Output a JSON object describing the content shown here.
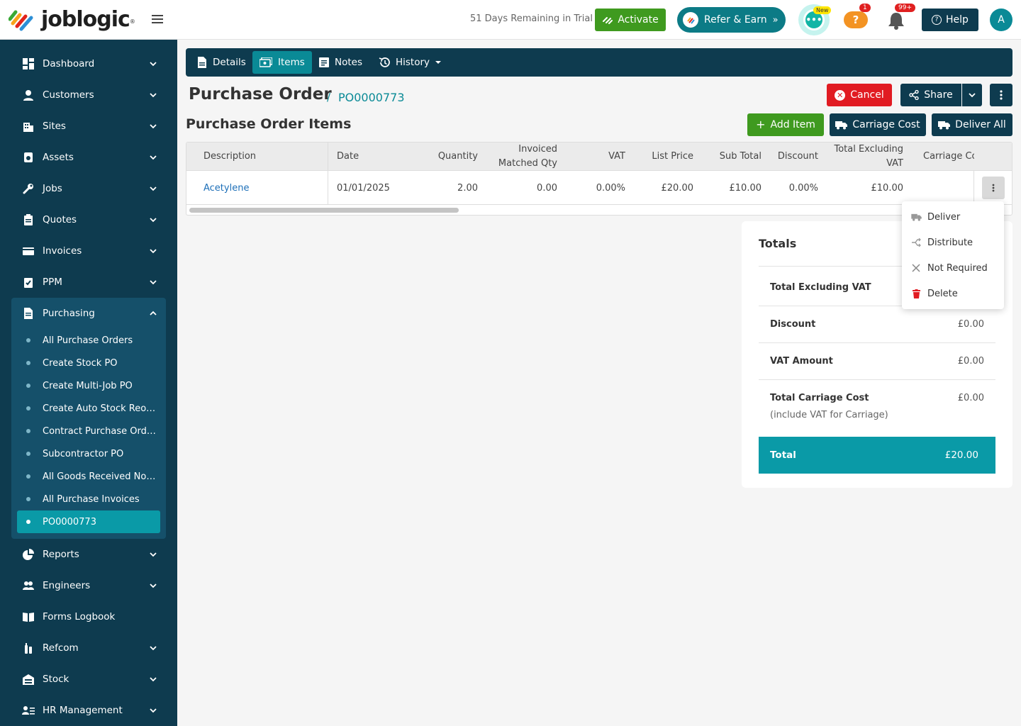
{
  "brand": {
    "logo_text": "joblogic"
  },
  "topbar": {
    "trial_text": "51 Days Remaining in Trial",
    "activate_label": "Activate",
    "refer_label": "Refer & Earn",
    "chat_badge": "New",
    "help_badge": "1",
    "notifications_badge": "99+",
    "help_label": "Help",
    "avatar_initial": "A"
  },
  "sidebar": {
    "items": [
      {
        "label": "Dashboard"
      },
      {
        "label": "Customers"
      },
      {
        "label": "Sites"
      },
      {
        "label": "Assets"
      },
      {
        "label": "Jobs"
      },
      {
        "label": "Quotes"
      },
      {
        "label": "Invoices"
      },
      {
        "label": "PPM"
      },
      {
        "label": "Purchasing"
      },
      {
        "label": "Reports"
      },
      {
        "label": "Engineers"
      },
      {
        "label": "Forms Logbook"
      },
      {
        "label": "Refcom"
      },
      {
        "label": "Stock"
      },
      {
        "label": "HR Management"
      }
    ],
    "purchasing_sub": [
      {
        "label": "All Purchase Orders"
      },
      {
        "label": "Create Stock PO"
      },
      {
        "label": "Create Multi-Job PO"
      },
      {
        "label": "Create Auto Stock Reord..."
      },
      {
        "label": "Contract Purchase Orders"
      },
      {
        "label": "Subcontractor PO"
      },
      {
        "label": "All Goods Received Notes"
      },
      {
        "label": "All Purchase Invoices"
      },
      {
        "label": "PO0000773"
      }
    ]
  },
  "tabs": [
    {
      "label": "Details"
    },
    {
      "label": "Items"
    },
    {
      "label": "Notes"
    },
    {
      "label": "History"
    }
  ],
  "header": {
    "title": "Purchase Order",
    "separator": "/",
    "po_number": "PO0000773",
    "cancel_label": "Cancel",
    "share_label": "Share"
  },
  "items_section": {
    "title": "Purchase Order Items",
    "add_item_label": "Add Item",
    "carriage_cost_label": "Carriage Cost",
    "deliver_all_label": "Deliver All"
  },
  "table": {
    "columns": [
      "Description",
      "Date",
      "Quantity",
      "Invoiced",
      "Matched Qty",
      "VAT",
      "List Price",
      "Sub Total",
      "Discount",
      "Total Excluding",
      "VAT",
      "Carriage Co"
    ],
    "rows": [
      {
        "description": "Acetylene",
        "date": "01/01/2025",
        "quantity": "2.00",
        "invoiced_matched_qty": "0.00",
        "vat": "0.00%",
        "list_price": "£20.00",
        "sub_total": "£10.00",
        "discount": "0.00%",
        "total_excl_vat": "£10.00"
      }
    ]
  },
  "row_menu": {
    "items": [
      {
        "label": "Deliver"
      },
      {
        "label": "Distribute"
      },
      {
        "label": "Not Required"
      },
      {
        "label": "Delete"
      }
    ]
  },
  "totals": {
    "title": "Totals",
    "total_excl_vat_label": "Total Excluding VAT",
    "discount_label": "Discount",
    "discount_value": "£0.00",
    "vat_amount_label": "VAT Amount",
    "vat_amount_value": "£0.00",
    "carriage_label": "Total Carriage Cost",
    "carriage_value": "£0.00",
    "carriage_note": "(include VAT for Carriage)",
    "total_label": "Total",
    "total_value": "£20.00"
  },
  "colors": {
    "sidebar": "#0e3b4f",
    "accent": "#0a9aa7",
    "green": "#3f9a1f",
    "danger": "#e11b22"
  }
}
